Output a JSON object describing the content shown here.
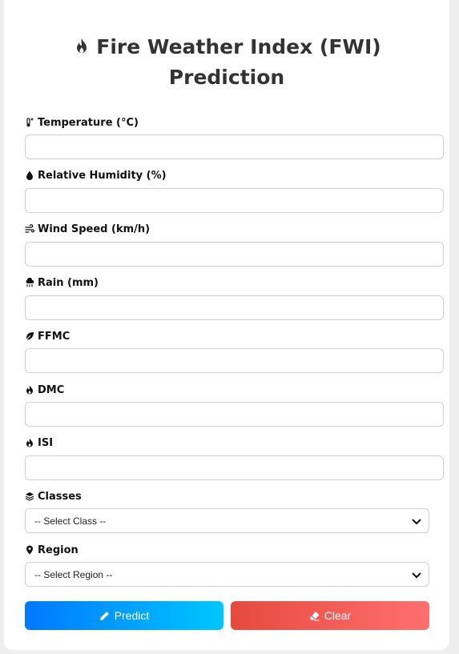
{
  "title": {
    "line1": "Fire Weather Index (FWI)",
    "line2": "Prediction",
    "icon": "fire-icon"
  },
  "fields": [
    {
      "label": "Temperature (°C)",
      "icon": "thermometer-icon",
      "value": ""
    },
    {
      "label": "Relative Humidity (%)",
      "icon": "droplet-icon",
      "value": ""
    },
    {
      "label": "Wind Speed (km/h)",
      "icon": "wind-icon",
      "value": ""
    },
    {
      "label": "Rain (mm)",
      "icon": "cloud-rain-icon",
      "value": ""
    },
    {
      "label": "FFMC",
      "icon": "leaf-icon",
      "value": ""
    },
    {
      "label": "DMC",
      "icon": "fire-icon",
      "value": ""
    },
    {
      "label": "ISI",
      "icon": "flame-icon",
      "value": ""
    }
  ],
  "selects": {
    "classes": {
      "label": "Classes",
      "icon": "layers-icon",
      "selected": "-- Select Class --"
    },
    "region": {
      "label": "Region",
      "icon": "map-pin-icon",
      "selected": "-- Select Region --"
    }
  },
  "buttons": {
    "predict": {
      "label": "Predict",
      "icon": "pencil-icon",
      "gradient": [
        "#0078ff",
        "#00c6ff"
      ]
    },
    "clear": {
      "label": "Clear",
      "icon": "eraser-icon",
      "gradient": [
        "#e64a3e",
        "#ff6f6f"
      ]
    }
  }
}
